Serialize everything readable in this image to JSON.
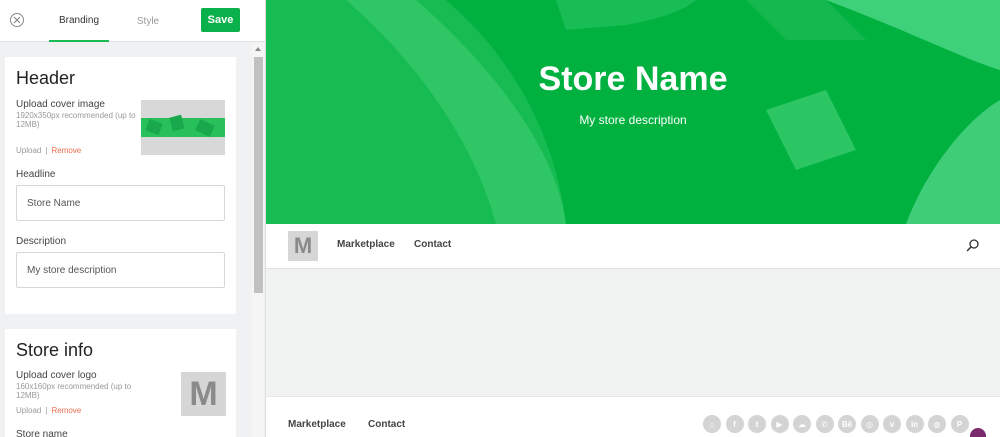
{
  "panel": {
    "tabs": [
      {
        "label": "Branding",
        "active": true
      },
      {
        "label": "Style",
        "active": false
      }
    ],
    "save_label": "Save",
    "header_card": {
      "title": "Header",
      "upload_cover_label": "Upload cover image",
      "cover_hint": "1920x350px recommended (up to 12MB)",
      "upload_link": "Upload",
      "separator": "|",
      "remove_link": "Remove",
      "headline_label": "Headline",
      "headline_value": "Store Name",
      "description_label": "Description",
      "description_value": "My store description"
    },
    "store_card": {
      "title": "Store info",
      "upload_logo_label": "Upload cover logo",
      "logo_hint": "160x160px recommended (up to 12MB)",
      "upload_link": "Upload",
      "separator": "|",
      "remove_link": "Remove",
      "logo_letter": "M",
      "store_name_label": "Store name"
    }
  },
  "preview": {
    "store_name": "Store Name",
    "store_description": "My store description",
    "nav": {
      "logo_letter": "M",
      "links": [
        "Marketplace",
        "Contact"
      ]
    },
    "footer": {
      "links": [
        "Marketplace",
        "Contact"
      ],
      "social_icons": [
        "home-icon",
        "facebook-icon",
        "twitter-icon",
        "youtube-icon",
        "soundcloud-icon",
        "whatsapp-icon",
        "behance-icon",
        "instagram-icon",
        "vimeo-icon",
        "linkedin-icon",
        "dribbble-icon",
        "patreon-icon"
      ],
      "social_glyphs": [
        "⌂",
        "f",
        "t",
        "▶",
        "☁",
        "✆",
        "Bē",
        "◎",
        "v",
        "in",
        "◍",
        "P"
      ]
    }
  },
  "colors": {
    "accent_green": "#00b140",
    "save_green": "#0ab04a",
    "remove_orange": "#e86d4c"
  }
}
